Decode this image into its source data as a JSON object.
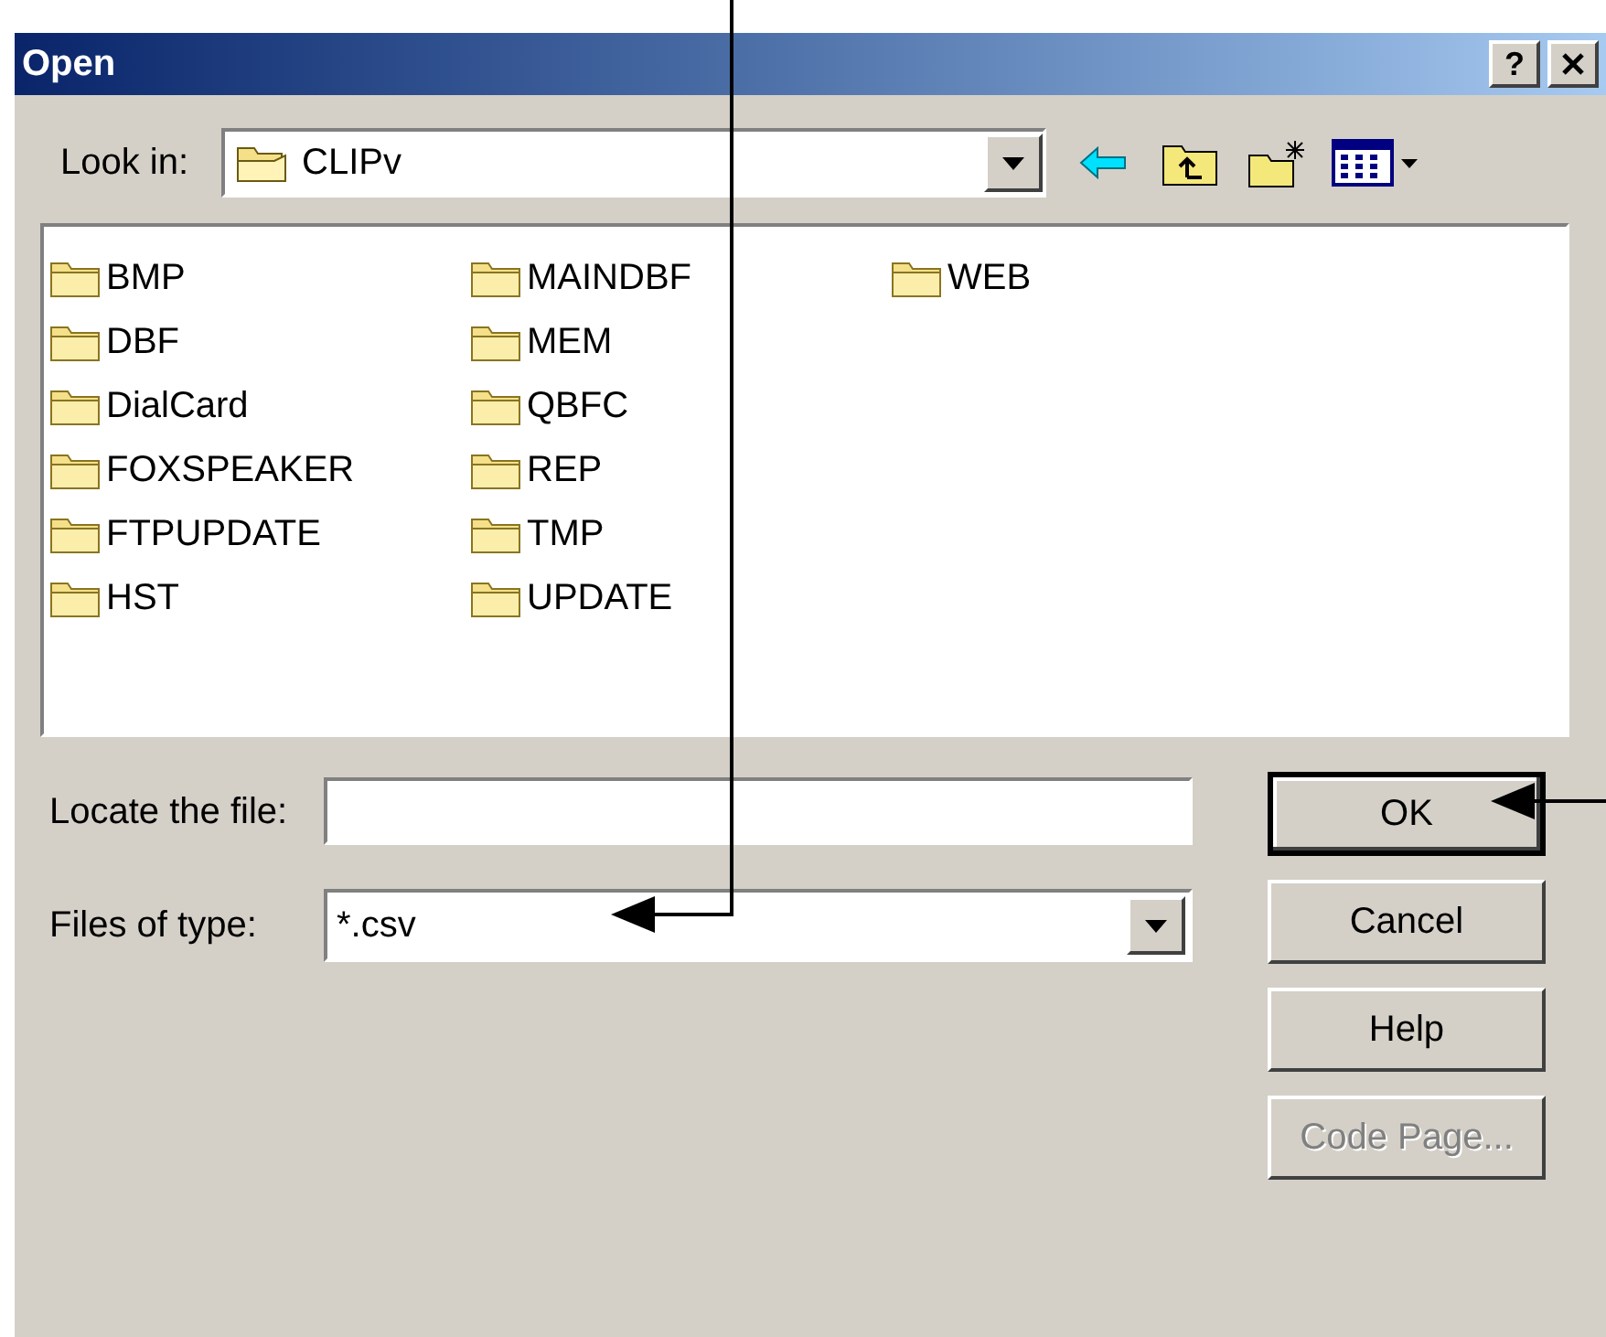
{
  "window": {
    "title": "Open",
    "help_button": "?"
  },
  "look_in": {
    "label": "Look in:",
    "value": "CLIPv"
  },
  "files": [
    "BMP",
    "DBF",
    "DialCard",
    "FOXSPEAKER",
    "FTPUPDATE",
    "HST",
    "MAINDBF",
    "MEM",
    "QBFC",
    "REP",
    "TMP",
    "UPDATE",
    "WEB"
  ],
  "locate": {
    "label": "Locate the file:"
  },
  "files_of_type": {
    "label": "Files of type:",
    "value": "*.csv"
  },
  "buttons": [
    {
      "label": "OK",
      "default": true,
      "disabled": false
    },
    {
      "label": "Cancel",
      "default": false,
      "disabled": false
    },
    {
      "label": "Help",
      "default": false,
      "disabled": false
    },
    {
      "label": "Code Page...",
      "default": false,
      "disabled": true
    }
  ]
}
